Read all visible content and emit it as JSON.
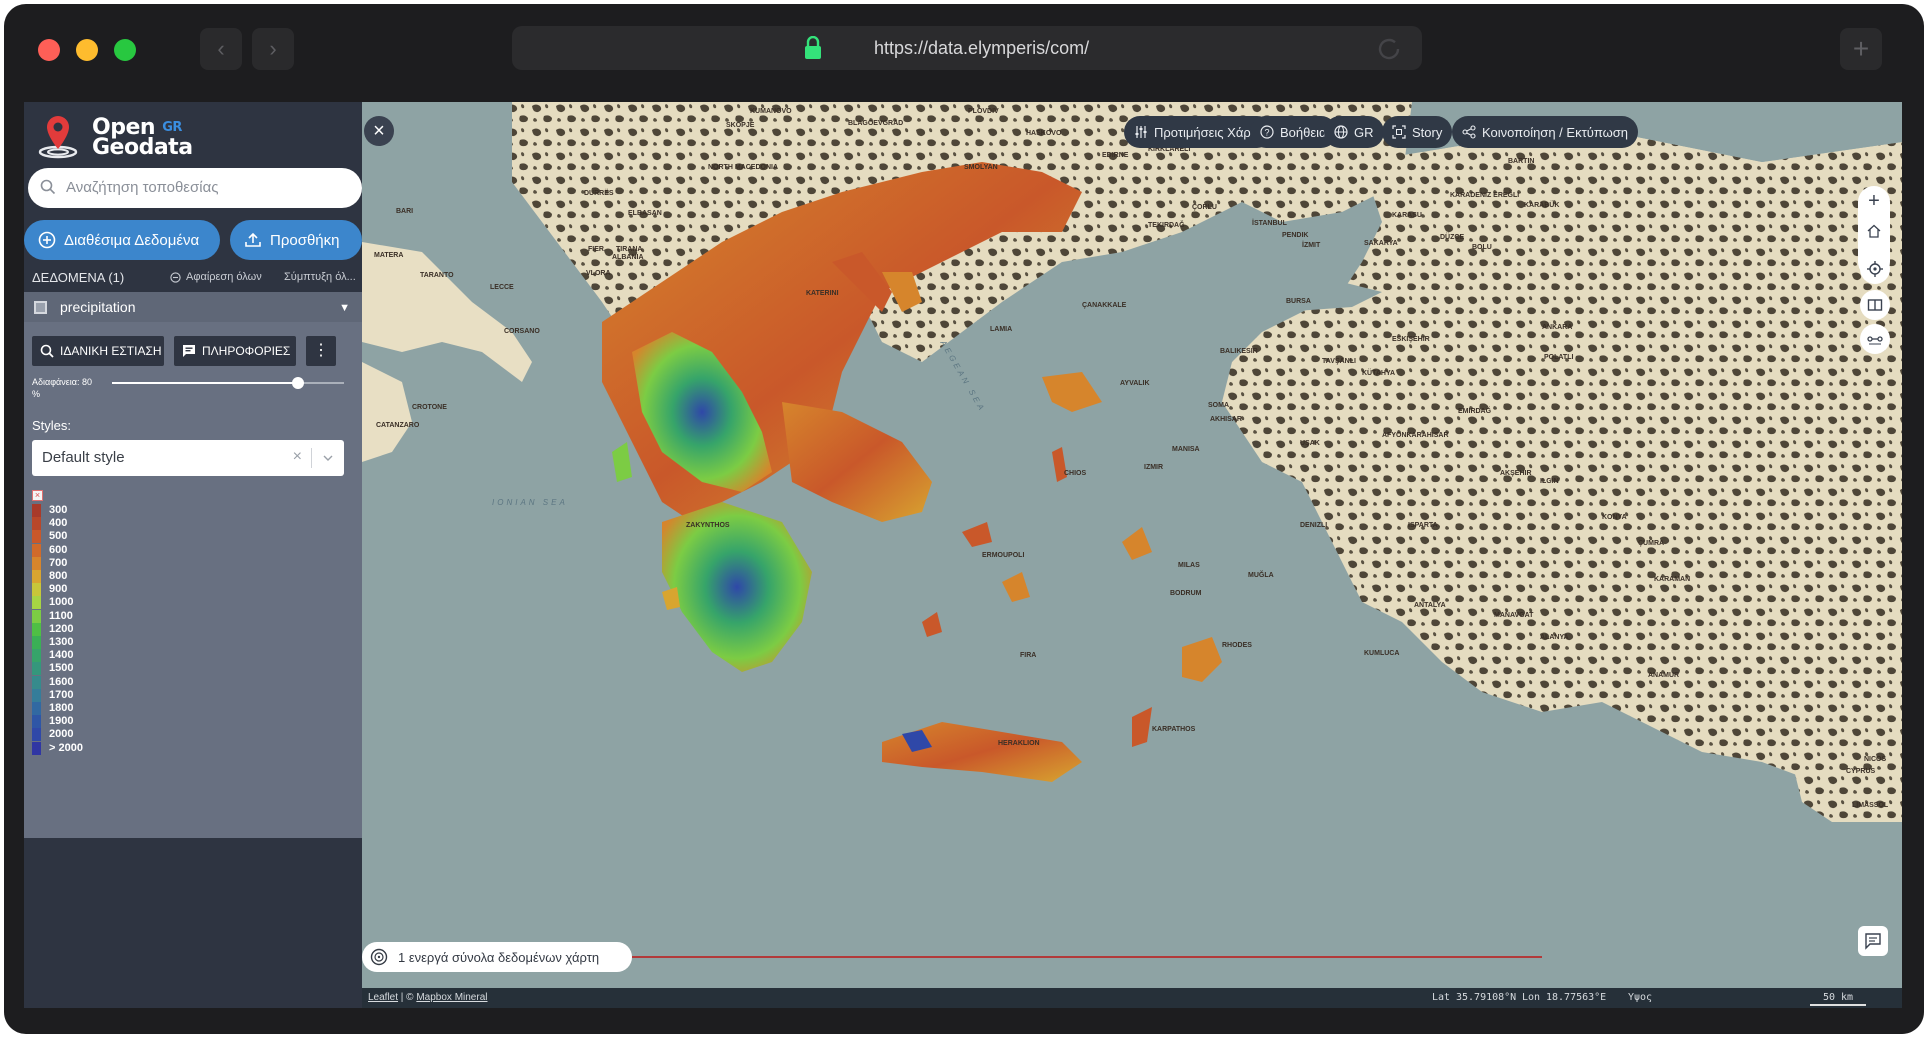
{
  "browser": {
    "url": "https://data.elymperis/com/"
  },
  "sidebar": {
    "logo": {
      "line1": "Open",
      "gr": "GR",
      "line2": "Geodata"
    },
    "search_placeholder": "Αναζήτηση τοποθεσίας",
    "available_button": "Διαθέσιμα Δεδομένα",
    "add_button": "Προσθήκη",
    "data_count": "ΔΕΔΟΜΕΝΑ (1)",
    "remove_all": "Αφαίρεση όλων",
    "collapse_all": "Σύμπτυξη όλ...",
    "layer": {
      "name": "precipitation",
      "zoom_button": "ΙΔΑΝΙΚΗ ΕΣΤΙΑΣΗ",
      "info_button": "ΠΛΗΡΟΦΟΡΙΕΣ",
      "opacity_label": "Αδιαφάνεια: 80",
      "opacity_unit": "%",
      "opacity_value": 80,
      "styles_label": "Styles:",
      "style_value": "Default style"
    },
    "legend": [
      {
        "label": "300",
        "color": "#a83a2a"
      },
      {
        "label": "400",
        "color": "#b8472a"
      },
      {
        "label": "500",
        "color": "#c9582a"
      },
      {
        "label": "600",
        "color": "#d06a2a"
      },
      {
        "label": "700",
        "color": "#d6852c"
      },
      {
        "label": "800",
        "color": "#d8a530"
      },
      {
        "label": "900",
        "color": "#c8c63a"
      },
      {
        "label": "1000",
        "color": "#a7d444"
      },
      {
        "label": "1100",
        "color": "#7ccc44"
      },
      {
        "label": "1200",
        "color": "#4fbf45"
      },
      {
        "label": "1300",
        "color": "#3ab056"
      },
      {
        "label": "1400",
        "color": "#36a46a"
      },
      {
        "label": "1500",
        "color": "#35977c"
      },
      {
        "label": "1600",
        "color": "#368b8c"
      },
      {
        "label": "1700",
        "color": "#357d9a"
      },
      {
        "label": "1800",
        "color": "#3169a2"
      },
      {
        "label": "1900",
        "color": "#2e56a6"
      },
      {
        "label": "2000",
        "color": "#2f48a8"
      },
      {
        "label": ">  2000",
        "color": "#3036a3"
      }
    ]
  },
  "map": {
    "toolbar": {
      "preferences": "Προτιμήσεις Χάρτη",
      "help": "Βοήθεια",
      "language": "GR",
      "story": "Story",
      "share": "Κοινοποίηση / Εκτύπωση"
    },
    "status": "1 ενεργά σύνολα δεδομένων χάρτη",
    "attribution": {
      "leaflet": "Leaflet",
      "sep": " | © ",
      "mapbox": "Mapbox Mineral"
    },
    "lat_label": "Lat",
    "lat_value": "35.79108°N",
    "lon_label": "Lon",
    "lon_value": "18.77563°E",
    "alt_label": "Υψος",
    "scale": "50 km",
    "labels": {
      "north_macedonia": "NORTH MACEDONIA",
      "albania": "ALBANIA",
      "ionian_sea": "IONIAN SEA",
      "aegean_sea": "AEGEAN SEA",
      "tirana": "TIRANA",
      "bari": "BARI",
      "durres": "DURRËS",
      "elbasan": "ELBASAN",
      "vlora": "VLORA",
      "fier": "FIER",
      "taranto": "TARANTO",
      "lecce": "LECCE",
      "matera": "MATERA",
      "corsano": "CORSANO",
      "crotone": "CROTONE",
      "catanzaro": "CATANZARO",
      "skopje": "SKOPJE",
      "kumanovo": "KUMANOVO",
      "blagoevgrad": "BLAGOEVGRAD",
      "plovdiv": "PLOVDIV",
      "haskovo": "HASKOVO",
      "edirne": "EDIRNE",
      "kirklareli": "KIRKLARELI",
      "smolyan": "SMOLYAN",
      "corlu": "ÇORLU",
      "tekirdag": "TEKIRDAĞ",
      "istanbul": "İSTANBUL",
      "pendik": "PENDIK",
      "izmit": "İZMIT",
      "sakarya": "SAKARYA",
      "duzce": "DÜZCE",
      "bartin": "BARTIN",
      "karabuk": "KARABÜK",
      "karadeniz_eregli": "KARADENIZ EREĞLI",
      "karasu": "KARASU",
      "bolu": "BOLU",
      "canakkale": "ÇANAKKALE",
      "bursa": "BURSA",
      "eskisehir": "ESKIŞEHIR",
      "ankara": "ANKARA",
      "balikesir": "BALIKESIR",
      "tavsanli": "TAVŞANLI",
      "kutahya": "KÜTAHYA",
      "polatli": "POLATLI",
      "ayvalik": "AYVALIK",
      "soma": "SOMA",
      "emirdag": "EMIRDAĞ",
      "akhisar": "AKHISAR",
      "afyonkarahisar": "AFYONKARAHISAR",
      "usak": "UŞAK",
      "manisa": "MANISA",
      "izmir": "IZMIR",
      "aksehir": "AKŞEHIR",
      "ilgin": "ILGIN",
      "chios": "CHIOS",
      "denizli": "DENIZLI",
      "konya": "KONYA",
      "isparta": "ISPARTA",
      "cumra": "ÇUMRA",
      "milas": "MILAS",
      "mugla": "MUĞLA",
      "bodrum": "BODRUM",
      "karaman": "KARAMAN",
      "antalya": "ANTALYA",
      "manavgat": "MANAVGAT",
      "alanya": "ALANYA",
      "kumluca": "KUMLUCA",
      "anamur": "ANAMUR",
      "rhodes": "RHODES",
      "karpathos": "KARPATHOS",
      "heraklion": "HERAKLION",
      "fira": "FIRA",
      "ermoupoli": "ERMOUPOLI",
      "zakynthos": "ZAKYNTHOS",
      "kateriní": "KATERINI",
      "lamia": "LAMIA",
      "nicosia": "NICOS",
      "cyprus": "CYPRUS",
      "limassol": "LIMASSOL"
    }
  }
}
